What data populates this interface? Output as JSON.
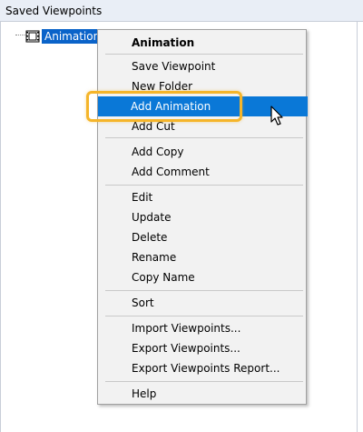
{
  "panel": {
    "title": "Saved Viewpoints"
  },
  "tree": {
    "items": [
      {
        "label": "Animation",
        "icon": "film-icon",
        "selected": true
      }
    ]
  },
  "context_menu": {
    "header": "Animation",
    "groups": [
      [
        "Save Viewpoint",
        "New Folder",
        "Add Animation",
        "Add Cut"
      ],
      [
        "Add Copy",
        "Add Comment"
      ],
      [
        "Edit",
        "Update",
        "Delete",
        "Rename",
        "Copy Name"
      ],
      [
        "Sort"
      ],
      [
        "Import Viewpoints...",
        "Export Viewpoints...",
        "Export Viewpoints Report..."
      ],
      [
        "Help"
      ]
    ],
    "active_item": "Add Animation"
  },
  "colors": {
    "selection": "#0a78d7",
    "highlight_outline": "#f5b52a",
    "menu_background": "#f2f2f2"
  }
}
